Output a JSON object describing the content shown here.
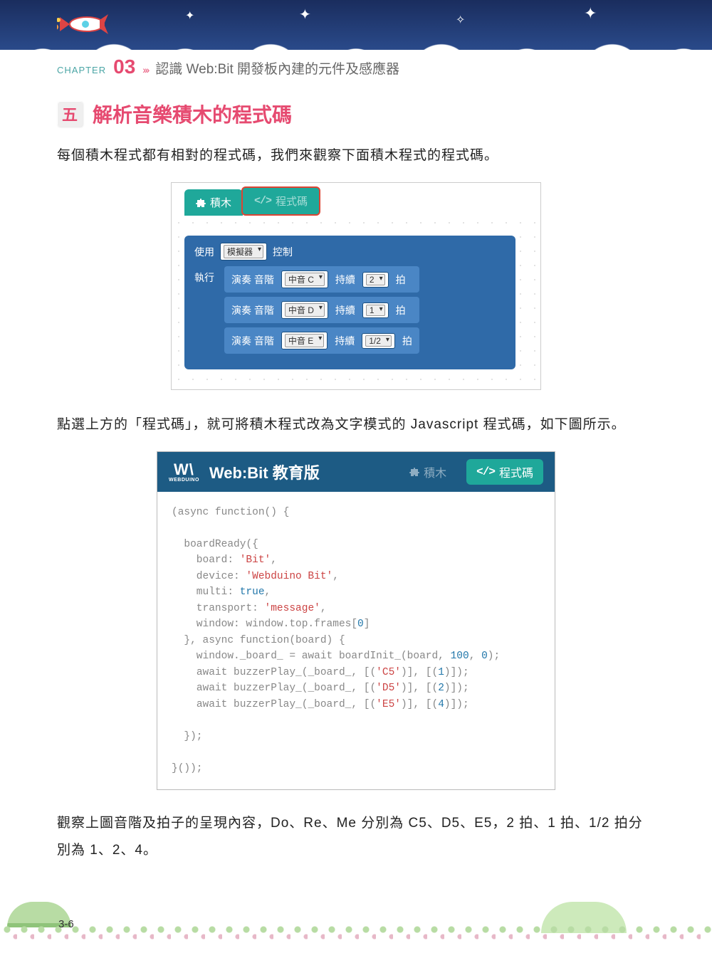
{
  "header": {
    "chapter_label": "CHAPTER",
    "chapter_num": "03",
    "arrows": "›››",
    "title": "認識 Web:Bit 開發板內建的元件及感應器"
  },
  "section": {
    "badge": "五",
    "title": "解析音樂積木的程式碼"
  },
  "paragraphs": {
    "p1": "每個積木程式都有相對的程式碼，我們來觀察下面積木程式的程式碼。",
    "p2": "點選上方的「程式碼」，就可將積木程式改為文字模式的 Javascript 程式碼，如下圖所示。",
    "p3": "觀察上圖音階及拍子的呈現內容，Do、Re、Me 分別為 C5、D5、E5，2 拍、1 拍、1/2 拍分別為 1、2、4。"
  },
  "fig1": {
    "tab_blocks": "積木",
    "tab_code": "程式碼",
    "label_use": "使用",
    "dd_device": "模擬器",
    "label_control": "控制",
    "label_run": "執行",
    "rows": [
      {
        "play": "演奏 音階",
        "note": "中音 C",
        "dur_label": "持續",
        "beat": "2",
        "beat_label": "拍"
      },
      {
        "play": "演奏 音階",
        "note": "中音 D",
        "dur_label": "持續",
        "beat": "1",
        "beat_label": "拍"
      },
      {
        "play": "演奏 音階",
        "note": "中音 E",
        "dur_label": "持續",
        "beat": "1/2",
        "beat_label": "拍"
      }
    ]
  },
  "fig2": {
    "brand_top": "W\\",
    "brand_sub": "WEBDUINO",
    "title": "Web:Bit 教育版",
    "tab_blocks": "積木",
    "tab_code": "程式碼",
    "code_tokens": [
      {
        "t": "(",
        "c": ""
      },
      {
        "t": "async function",
        "c": "kw"
      },
      {
        "t": "() {\n\n  boardReady({\n    board: ",
        "c": ""
      },
      {
        "t": "'Bit'",
        "c": "str"
      },
      {
        "t": ",\n    device: ",
        "c": ""
      },
      {
        "t": "'Webduino Bit'",
        "c": "str"
      },
      {
        "t": ",\n    multi: ",
        "c": ""
      },
      {
        "t": "true",
        "c": "num"
      },
      {
        "t": ",\n    transport: ",
        "c": ""
      },
      {
        "t": "'message'",
        "c": "str"
      },
      {
        "t": ",\n    window: window.top.frames[",
        "c": ""
      },
      {
        "t": "0",
        "c": "num"
      },
      {
        "t": "]\n  }, ",
        "c": ""
      },
      {
        "t": "async function",
        "c": "kw"
      },
      {
        "t": "(board) {\n    window._board_ = ",
        "c": ""
      },
      {
        "t": "await",
        "c": "kw"
      },
      {
        "t": " boardInit_(board, ",
        "c": ""
      },
      {
        "t": "100",
        "c": "num"
      },
      {
        "t": ", ",
        "c": ""
      },
      {
        "t": "0",
        "c": "num"
      },
      {
        "t": ");\n    ",
        "c": ""
      },
      {
        "t": "await",
        "c": "kw"
      },
      {
        "t": " buzzerPlay_(_board_, [(",
        "c": ""
      },
      {
        "t": "'C5'",
        "c": "str"
      },
      {
        "t": ")], [(",
        "c": ""
      },
      {
        "t": "1",
        "c": "num"
      },
      {
        "t": ")]);\n    ",
        "c": ""
      },
      {
        "t": "await",
        "c": "kw"
      },
      {
        "t": " buzzerPlay_(_board_, [(",
        "c": ""
      },
      {
        "t": "'D5'",
        "c": "str"
      },
      {
        "t": ")], [(",
        "c": ""
      },
      {
        "t": "2",
        "c": "num"
      },
      {
        "t": ")]);\n    ",
        "c": ""
      },
      {
        "t": "await",
        "c": "kw"
      },
      {
        "t": " buzzerPlay_(_board_, [(",
        "c": ""
      },
      {
        "t": "'E5'",
        "c": "str"
      },
      {
        "t": ")], [(",
        "c": ""
      },
      {
        "t": "4",
        "c": "num"
      },
      {
        "t": ")]);\n\n  });\n\n}());",
        "c": ""
      }
    ]
  },
  "page_number": "3-6"
}
